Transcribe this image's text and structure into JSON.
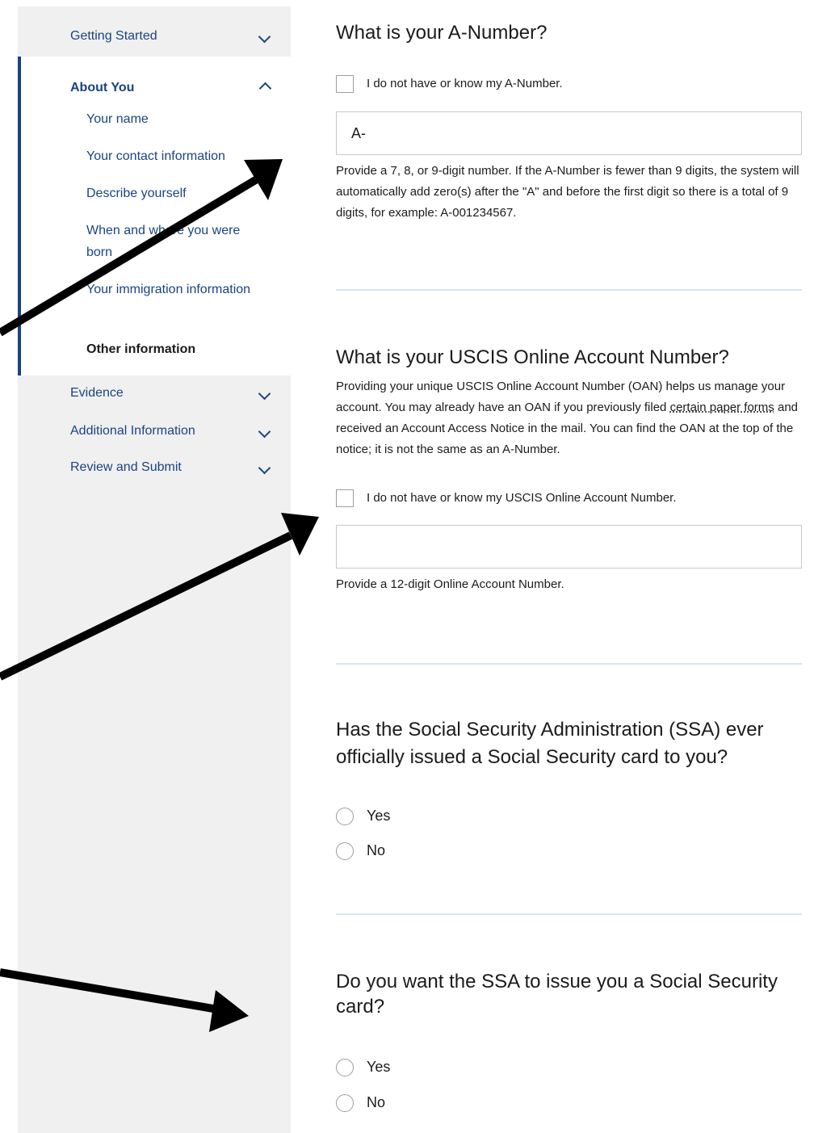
{
  "sidebar": {
    "getting_started": "Getting Started",
    "about_you": "About You",
    "sub_items": [
      "Your name",
      "Your contact information",
      "Describe yourself",
      "When and where you were born",
      "Your immigration information",
      "Other information"
    ],
    "current_item": "Other information",
    "evidence": "Evidence",
    "additional": "Additional Information",
    "review": "Review and Submit"
  },
  "anumber": {
    "title": "What is your A-Number?",
    "checkbox_label": "I do not have or know my A-Number.",
    "input_value": "A-",
    "help": "Provide a 7, 8, or 9-digit number. If the A-Number is fewer than 9 digits, the system will automatically add zero(s) after the \"A\" and before the first digit so there is a total of 9 digits, for example: A-001234567."
  },
  "oan": {
    "title": "What is your USCIS Online Account Number?",
    "desc_before": "Providing your unique USCIS Online Account Number (OAN) helps us manage your account. You may already have an OAN if you previously filed ",
    "desc_link": "certain paper forms",
    "desc_after": " and received an Account Access Notice in the mail. You can find the OAN at the top of the notice; it is not the same as an A-Number.",
    "checkbox_label": "I do not have or know my USCIS Online Account Number.",
    "input_value": "",
    "help": "Provide a 12-digit Online Account Number."
  },
  "ssa_issued": {
    "title": "Has the Social Security Administration (SSA) ever officially issued a Social Security card to you?",
    "yes": "Yes",
    "no": "No"
  },
  "ssa_want": {
    "title": "Do you want the SSA to issue you a Social Security card?",
    "yes": "Yes",
    "no": "No"
  },
  "colors": {
    "sidebar_bg": "#f0f0f0",
    "accent": "#1a4480",
    "divider": "#d6e6f2",
    "arrow": "#000000"
  }
}
